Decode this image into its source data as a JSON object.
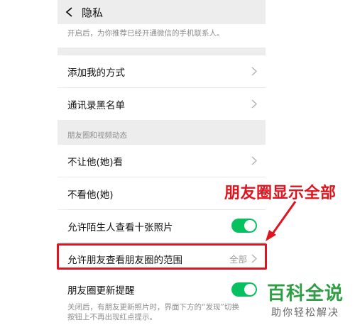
{
  "header": {
    "title": "隐私"
  },
  "top_hint": "开启后，为你推荐已经开通微信的手机联系人。",
  "menu_items": [
    {
      "label": "添加我的方式"
    },
    {
      "label": "通讯录黑名单"
    }
  ],
  "section_label": "朋友圈和视频动态",
  "moments_items": [
    {
      "label": "不让他(她)看"
    },
    {
      "label": "不看他(她)"
    },
    {
      "label": "允许陌生人查看十张照片"
    },
    {
      "label": "允许朋友查看朋友圈的范围",
      "value": "全部"
    },
    {
      "label": "朋友圈更新提醒"
    }
  ],
  "toggles": {
    "stranger_photos": true,
    "moments_reminder": true
  },
  "bottom_hint_lines": [
    "关闭后，有朋友更新照片时，界面下方的“发现”切换",
    "按钮上不再出现红点提示。"
  ],
  "annotation_text": "朋友圈显示全部",
  "watermark": {
    "title": "百科全说",
    "subtitle": "助你轻松解决"
  },
  "colors": {
    "accent_green": "#07c160",
    "annotation_red": "#e0141e",
    "watermark_green": "#2f9e44"
  }
}
